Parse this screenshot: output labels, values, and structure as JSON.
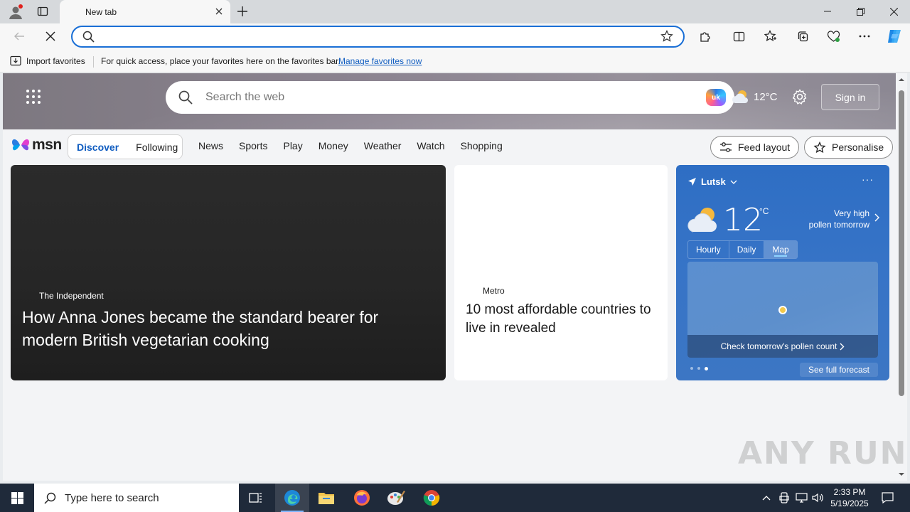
{
  "browser": {
    "tab_title": "New tab",
    "address_placeholder": "",
    "favorites_bar": {
      "import_label": "Import favorites",
      "hint": "For quick access, place your favorites here on the favorites bar.",
      "manage_link": "Manage favorites now"
    }
  },
  "msn": {
    "search_placeholder": "Search the web",
    "copilot_badge": "uk",
    "header_temp": "12°C",
    "sign_in": "Sign in",
    "logo_text": "msn",
    "pills": [
      "Discover",
      "Following"
    ],
    "nav": [
      "News",
      "Sports",
      "Play",
      "Money",
      "Weather",
      "Watch",
      "Shopping"
    ],
    "feed_layout": "Feed layout",
    "personalise": "Personalise"
  },
  "cards": {
    "main": {
      "source": "The Independent",
      "title": "How Anna Jones became the standard bearer for modern British vegetarian cooking"
    },
    "mid": {
      "source": "Metro",
      "title": "10 most affordable countries to live in revealed"
    }
  },
  "weather": {
    "location": "Lutsk",
    "more": "···",
    "temp": "12",
    "unit": "°C",
    "pollen_line1": "Very high",
    "pollen_line2": "pollen tomorrow",
    "tabs": [
      "Hourly",
      "Daily",
      "Map"
    ],
    "active_tab": "Map",
    "map_cta": "Check tomorrow's pollen count",
    "forecast_link": "See full forecast"
  },
  "watermark": "ANY RUN",
  "taskbar": {
    "search_placeholder": "Type here to search",
    "time": "2:33 PM",
    "date": "5/19/2025"
  },
  "colors": {
    "accent": "#1a6fd6",
    "link": "#0f5cc0",
    "weather_bg": "#3774c7",
    "taskbar": "#1f2a3a"
  }
}
